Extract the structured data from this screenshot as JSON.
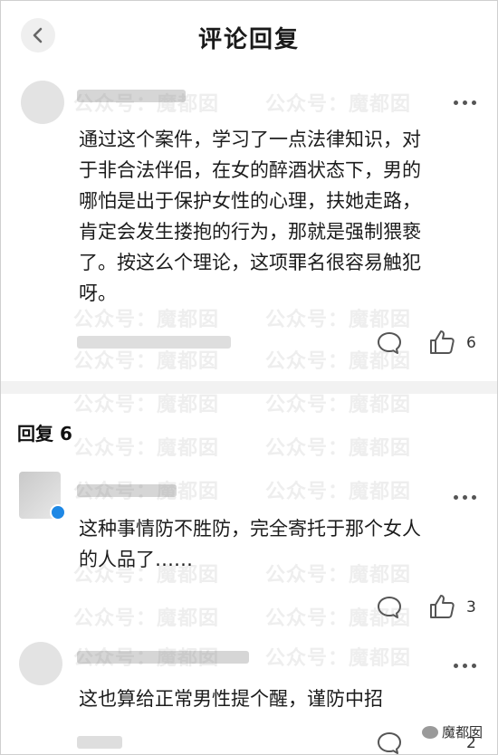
{
  "header": {
    "title": "评论回复"
  },
  "main_comment": {
    "text_lines": [
      "通过这个案件，学习了一点法律知识，对",
      "于非合法伴侣，在女的醉酒状态下，男的",
      "哪怕是出于保护女性的心理，扶她走路，",
      "肯定会发生搂抱的行为，那就是强制猥亵",
      "了。按这么个理论，这项罪名很容易触犯",
      "呀。"
    ],
    "like_count": "6"
  },
  "replies_header": {
    "label": "回复 6"
  },
  "replies": [
    {
      "text_lines": [
        "这种事情防不胜防，完全寄托于那个女人",
        "的人品了……"
      ],
      "like_count": "3"
    },
    {
      "text_lines": [
        "这也算给正常男性提个醒，谨防中招"
      ],
      "like_count": "2"
    }
  ],
  "watermark": {
    "text": "公众号：魔都囡"
  },
  "corner_watermark": {
    "text": "魔都囡"
  },
  "colors": {
    "verified": "#1e88e5",
    "divider": "#f2f2f2",
    "text": "#1c1c1c"
  },
  "icons": [
    "back-chevron-icon",
    "more-icon",
    "comment-icon",
    "like-icon"
  ]
}
